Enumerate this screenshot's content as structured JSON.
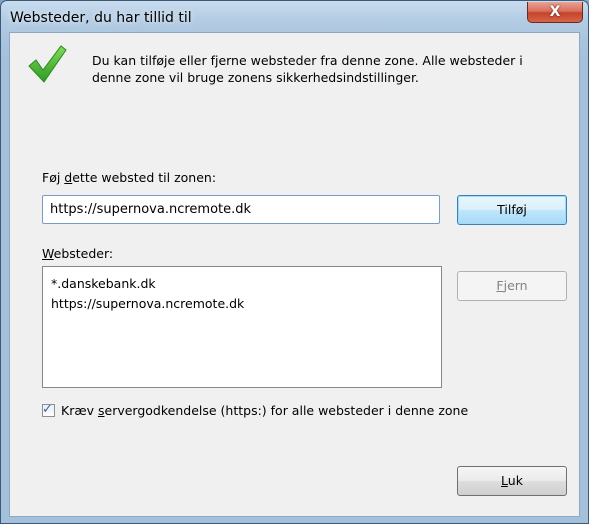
{
  "window": {
    "title": "Websteder, du har tillid til",
    "close_glyph": "X"
  },
  "description": "Du kan tilføje eller fjerne websteder fra denne zone. Alle websteder i denne zone vil bruge zonens sikkerhedsindstillinger.",
  "add_site": {
    "label_prefix": "Føj ",
    "label_access": "d",
    "label_rest": "ette websted til zonen:",
    "input_value": "https://supernova.ncremote.dk",
    "add_button": "Tilføj"
  },
  "sites": {
    "label_access": "W",
    "label_rest": "ebsteder:",
    "items": [
      "*.danskebank.dk",
      "https://supernova.ncremote.dk"
    ],
    "remove_button_access": "F",
    "remove_button_rest": "jern"
  },
  "require_https": {
    "checked": true,
    "label_prefix": "Kræv ",
    "label_access": "s",
    "label_rest": "ervergodkendelse (https:) for alle websteder i denne zone"
  },
  "close_button_access": "L",
  "close_button_rest": "uk",
  "icons": {
    "info": "green-checkmark-icon",
    "close": "close-x-icon"
  },
  "colors": {
    "close_button": "#c5432c",
    "accent_border": "#3c7fb1"
  }
}
